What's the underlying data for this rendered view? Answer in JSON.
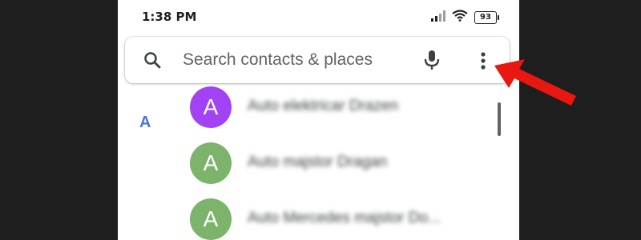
{
  "status_bar": {
    "time": "1:38 PM",
    "battery": "93",
    "icons": [
      "signal-icon",
      "wifi-icon",
      "battery-icon"
    ]
  },
  "search": {
    "placeholder": "Search contacts & places",
    "icons": [
      "search-icon",
      "mic-icon",
      "more-options-icon"
    ]
  },
  "contacts": {
    "section_letter": "A",
    "items": [
      {
        "initial": "A",
        "name": "Auto elektricar Drazen",
        "avatar_color": "#a142f4"
      },
      {
        "initial": "A",
        "name": "Auto majstor Dragan",
        "avatar_color": "#7cb46b"
      },
      {
        "initial": "A",
        "name": "Auto Mercedes majstor Do...",
        "avatar_color": "#7cb46b"
      }
    ]
  },
  "annotation": {
    "arrow_color": "#e8170f",
    "target": "more-options-icon"
  },
  "colors": {
    "section_letter": "#4a76d4",
    "placeholder": "#5f6368"
  }
}
